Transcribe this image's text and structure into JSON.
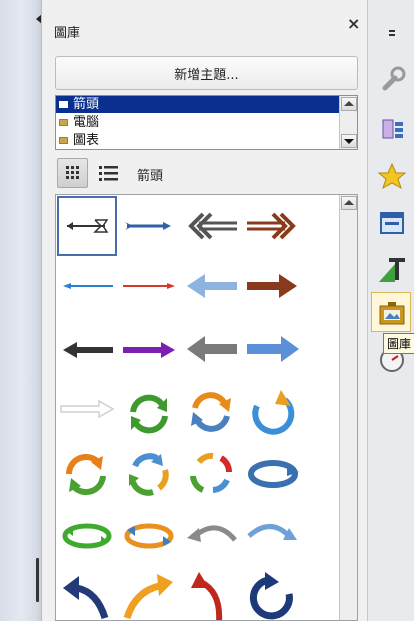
{
  "panel": {
    "title": "圖庫",
    "close": "×",
    "new_theme_label": "新增主題...",
    "themes": [
      "箭頭",
      "電腦",
      "圖表"
    ],
    "selected_theme_index": 0,
    "current_theme": "箭頭"
  },
  "gallery": {
    "items": [
      "arrow-tail-hollow",
      "arrow-tail-blue",
      "arrow-double-left-gray",
      "arrow-double-right-brown",
      "arrow-thin-blue",
      "arrow-thin-red",
      "arrow-left-lightblue",
      "arrow-right-brown",
      "arrow-left-dark",
      "arrow-right-purple",
      "arrow-left-gray",
      "arrow-right-blue",
      "arrow-hollow-right",
      "cycle-green",
      "cycle-orange-blue",
      "refresh-blue",
      "cycle-orange-green",
      "cycle-multicolor",
      "cycle-four-color",
      "ring-arrow-blue",
      "oval-arrows-green",
      "oval-arrows-orange",
      "curve-left-gray",
      "curve-right-blue",
      "bend-left-navy",
      "curve-up-orange",
      "bend-down-red",
      "circle-arrow-navy"
    ],
    "selected_index": 0
  },
  "right_rail": {
    "icons": [
      "settings-wrench-icon",
      "navigator-icon",
      "styles-star-icon",
      "properties-icon",
      "text-icon",
      "gallery-icon",
      "clock-icon"
    ],
    "tooltip": "圖庫"
  },
  "left_strip": {
    "handle": "collapse-arrow"
  }
}
